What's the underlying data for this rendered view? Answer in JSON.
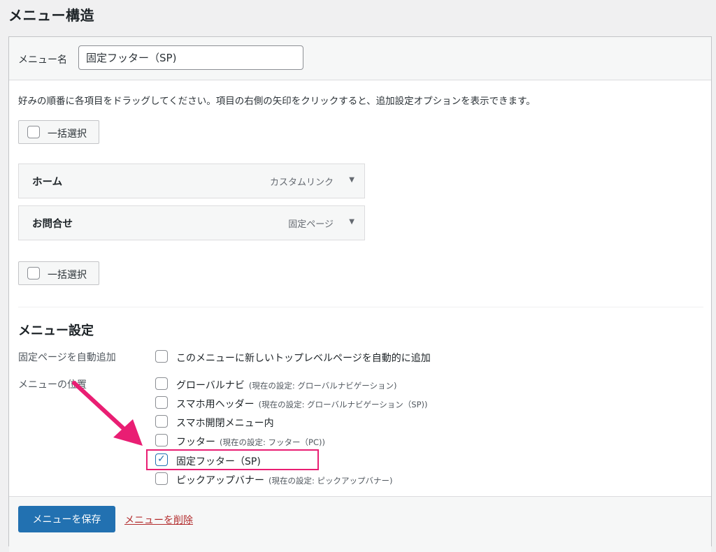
{
  "page_title": "メニュー構造",
  "menu_name": {
    "label": "メニュー名",
    "value": "固定フッター（SP)"
  },
  "instructions": "好みの順番に各項目をドラッグしてください。項目の右側の矢印をクリックすると、追加設定オプションを表示できます。",
  "bulk_select_label": "一括選択",
  "menu_items": [
    {
      "title": "ホーム",
      "type": "カスタムリンク"
    },
    {
      "title": "お問合せ",
      "type": "固定ページ"
    }
  ],
  "settings": {
    "title": "メニュー設定",
    "auto_add_label": "固定ページを自動追加",
    "auto_add_option": "このメニューに新しいトップレベルページを自動的に追加",
    "location_label": "メニューの位置",
    "locations": [
      {
        "name": "グローバルナビ",
        "note": "(現在の設定: グローバルナビゲーション)",
        "checked": false
      },
      {
        "name": "スマホ用ヘッダー",
        "note": "(現在の設定: グローバルナビゲーション（SP))",
        "checked": false
      },
      {
        "name": "スマホ開閉メニュー内",
        "note": "",
        "checked": false
      },
      {
        "name": "フッター",
        "note": "(現在の設定: フッター（PC))",
        "checked": false
      },
      {
        "name": "固定フッター（SP)",
        "note": "",
        "checked": true
      },
      {
        "name": "ピックアップバナー",
        "note": "(現在の設定: ピックアップバナー)",
        "checked": false
      }
    ]
  },
  "footer": {
    "save_label": "メニューを保存",
    "delete_label": "メニューを削除"
  },
  "colors": {
    "accent": "#2271b1",
    "highlight": "#e91e73",
    "delete": "#b32d2e"
  }
}
